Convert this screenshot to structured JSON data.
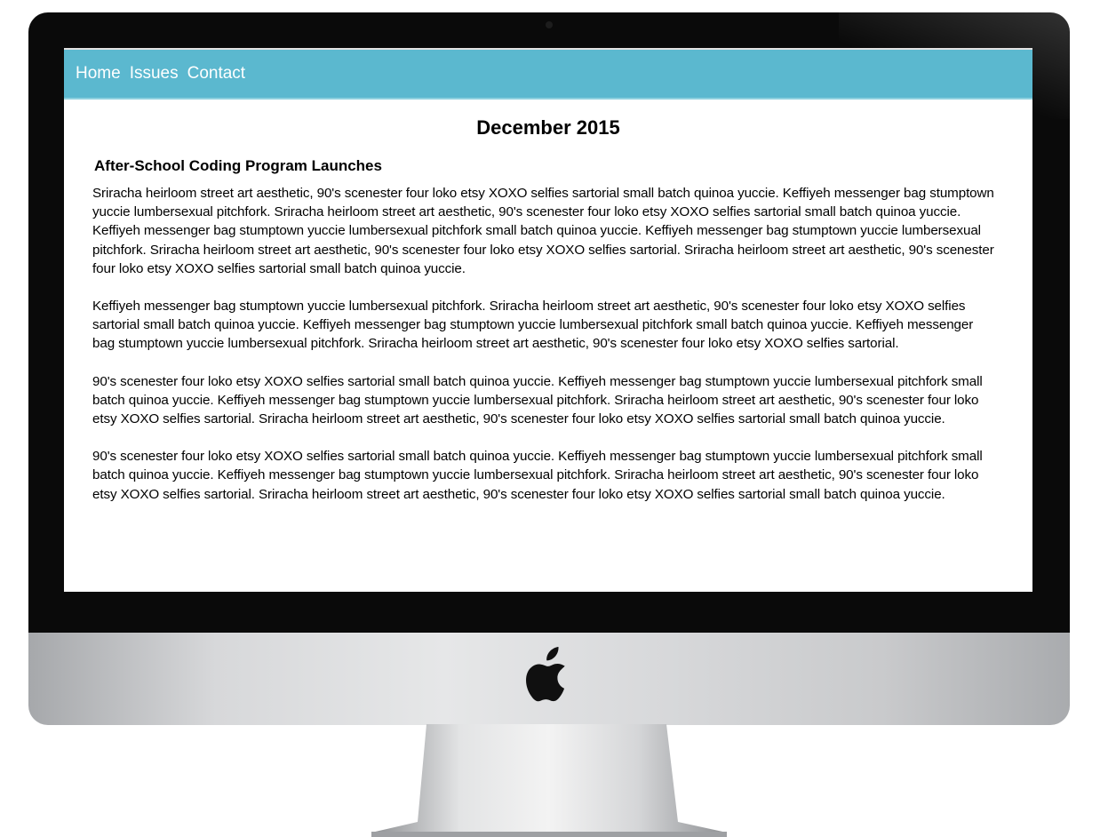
{
  "nav": {
    "items": [
      {
        "label": "Home"
      },
      {
        "label": "Issues"
      },
      {
        "label": "Contact"
      }
    ]
  },
  "page": {
    "title": "December 2015"
  },
  "article": {
    "heading": "After-School Coding Program Launches",
    "paragraphs": [
      "Sriracha heirloom street art aesthetic, 90's scenester four loko etsy XOXO selfies sartorial small batch quinoa yuccie. Keffiyeh messenger bag stumptown yuccie lumbersexual pitchfork. Sriracha heirloom street art aesthetic, 90's scenester four loko etsy XOXO selfies sartorial small batch quinoa yuccie. Keffiyeh messenger bag stumptown yuccie lumbersexual pitchfork small batch quinoa yuccie. Keffiyeh messenger bag stumptown yuccie lumbersexual pitchfork. Sriracha heirloom street art aesthetic, 90's scenester four loko etsy XOXO selfies sartorial. Sriracha heirloom street art aesthetic, 90's scenester four loko etsy XOXO selfies sartorial small batch quinoa yuccie.",
      " Keffiyeh messenger bag stumptown yuccie lumbersexual pitchfork. Sriracha heirloom street art aesthetic, 90's scenester four loko etsy XOXO selfies sartorial small batch quinoa yuccie. Keffiyeh messenger bag stumptown yuccie lumbersexual pitchfork small batch quinoa yuccie. Keffiyeh messenger bag stumptown yuccie lumbersexual pitchfork. Sriracha heirloom street art aesthetic, 90's scenester four loko etsy XOXO selfies sartorial.",
      " 90's scenester four loko etsy XOXO selfies sartorial small batch quinoa yuccie. Keffiyeh messenger bag stumptown yuccie lumbersexual pitchfork small batch quinoa yuccie. Keffiyeh messenger bag stumptown yuccie lumbersexual pitchfork. Sriracha heirloom street art aesthetic, 90's scenester four loko etsy XOXO selfies sartorial. Sriracha heirloom street art aesthetic, 90's scenester four loko etsy XOXO selfies sartorial small batch quinoa yuccie.",
      " 90's scenester four loko etsy XOXO selfies sartorial small batch quinoa yuccie. Keffiyeh messenger bag stumptown yuccie lumbersexual pitchfork small batch quinoa yuccie. Keffiyeh messenger bag stumptown yuccie lumbersexual pitchfork. Sriracha heirloom street art aesthetic, 90's scenester four loko etsy XOXO selfies sartorial. Sriracha heirloom street art aesthetic, 90's scenester four loko etsy XOXO selfies sartorial small batch quinoa yuccie."
    ]
  },
  "device": {
    "logo_icon": "apple-logo-icon",
    "nav_color": "#5bb8cf"
  }
}
